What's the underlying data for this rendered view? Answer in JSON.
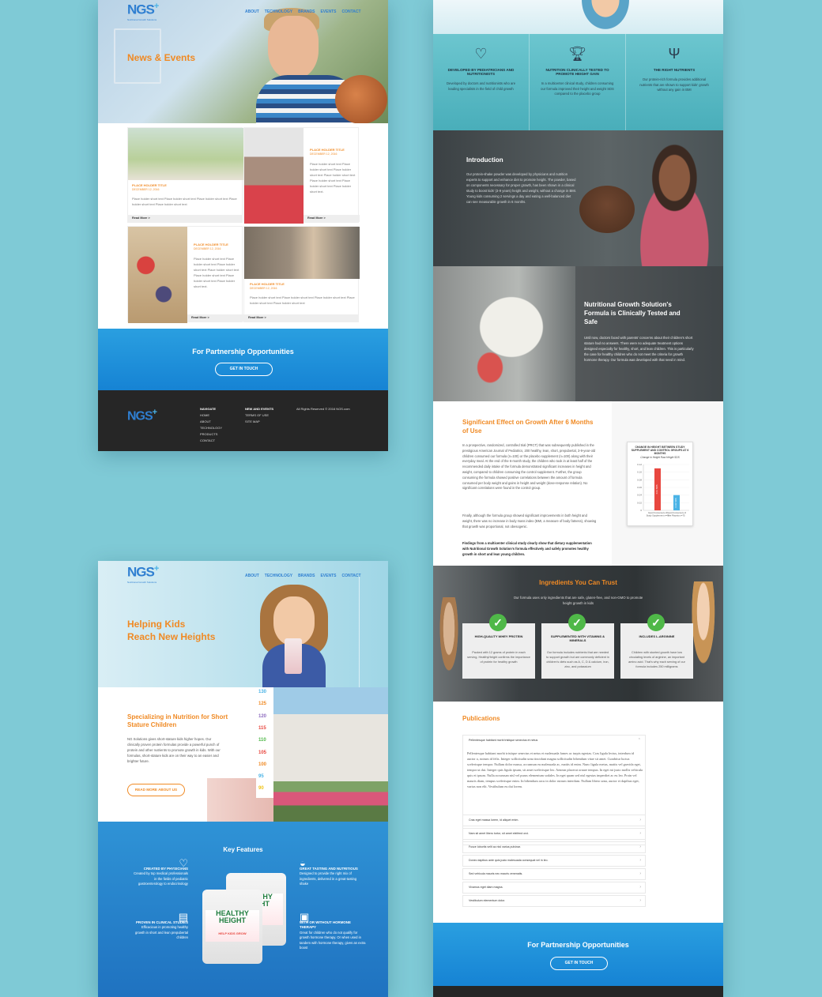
{
  "brand": {
    "logo": "NGS",
    "plus": "+",
    "tagline": "Nutritional Growth Solutions"
  },
  "nav": [
    "ABOUT",
    "TECHNOLOGY",
    "BRANDS",
    "EVENTS",
    "CONTACT"
  ],
  "news": {
    "title": "News & Events",
    "card_title": "PLACE HOLDER TITLE",
    "card_date": "DECEMBER 12, 2016",
    "short_text": "Place holder short text Place holder short text Place holder short text Place holder short text Place holder short text",
    "long_text": "Place holder short text Place holder short text Place holder short text Place holder short text Place holder short text Place holder short text Place holder short text.",
    "read_more": "Read More >"
  },
  "cta": {
    "title": "For Partnership Opportunities",
    "button": "GET IN TOUCH"
  },
  "footer": {
    "nav_head": "NAVIGATE",
    "nav_items": [
      "HOME",
      "ABOUT",
      "TECHNOLOGY",
      "PRODUCTS",
      "CONTACT"
    ],
    "col2": [
      "NEW AND EVENTS",
      "TERMS OF USE",
      "SITE MAP"
    ],
    "rights": "All Rights Reserved © 2016 NGS.com"
  },
  "features": [
    {
      "icon": "stethoscope-heart-icon",
      "title": "DEVELOPED BY PEDIATRICIANS AND NUTRITIONISTS",
      "text": "Developed by doctors and nutritionists who are leading specialists in the field of child growth"
    },
    {
      "icon": "trophy-icon",
      "title": "NUTRITION CLINICALLY TESTED TO PROMOTE HEIGHT GAIN",
      "text": "In a multicenter clinical study, children consuming our formula improved their height and weight SDS compared to the placebo group"
    },
    {
      "icon": "carrot-fork-icon",
      "title": "THE RIGHT NUTRIENTS",
      "text": "Our protein-rich formula provides additional nutrients that are shown to support kids' growth without any gain in BMI"
    }
  ],
  "intro": {
    "title": "Introduction",
    "text": "Our protein-shake powder was developed by physicians and nutrition experts to support and enhance diet to promote height. The powder, based on components necessary for proper growth, has been shown in a clinical study to boost kids' (3-9 years) height and weight, without a change in BMI. Young kids consuming 2 servings a day and eating a well-balanced diet can see measurable growth in 6 months."
  },
  "tested": {
    "title": "Nutritional Growth Solution's Formula is Clinically Tested and Safe",
    "text": "Until now, doctors faced with parents' concerns about their children's short stature had no answers. There were no adequate treatment options designed especially for healthy, short, and lean children. This is particularly the case for healthy children who do not meet the criteria for growth hormone therapy. Our formula was developed with that need in mind."
  },
  "effect": {
    "title": "Significant Effect on Growth After 6 Months of Use",
    "p1": "In a prospective, randomized, controlled trial (PRCT) that was subsequently published in the prestigious American Journal of Pediatrics, 200 healthy, lean, short, prepubertal, 3-9-year-old children consumed our formula (n=100) or the placebo supplement (n=100) along with their everyday meal. At the end of the 6-month study, the children who took in at least half of the recommended daily intake of the formula demonstrated significant increases in height and weight, compared to children consuming the control supplement. Further, the group consuming the formula showed positive correlations between the amount of formula consumed per body weight and gains in height and weight (dose-response relation). No significant correlations were found in the control group.",
    "p2": "Finally, although the formula group showed significant improvements in both height and weight, there was no increase in body mass index (BMI, a measure of body fatness), showing that growth was proportional, not obesogenic.",
    "p3": "Findings from a multicenter clinical study clearly show that dietary supplementation with Nutritional Growth Solution's formula effectively and safely promotes healthy growth in short and lean young children."
  },
  "chart_data": {
    "type": "bar",
    "title": "CHANGE IN HEIGHT BETWEEN STUDY SUPPLEMENT AND CONTROL GROUPS AT 6 MONTHS",
    "subtitle": "Change in Height Raw Height SDS",
    "categories": [
      "Good Consumers of Study Supplement n=49",
      "Good Consumers of the Placebo n=75"
    ],
    "values": [
      0.11,
      0.04
    ],
    "bar_labels": [
      "0.11 SDS",
      "0.04 SDS"
    ],
    "colors": [
      "#e8473f",
      "#4ab3e6"
    ],
    "yticks": [
      "0.12",
      "0.10",
      "0.08",
      "0.06",
      "0.04",
      "0.02",
      "0"
    ],
    "ylim": [
      0,
      0.12
    ]
  },
  "ingredients": {
    "title": "Ingredients You Can Trust",
    "sub": "Our formula uses only ingredients that are safe, gluten-free, and non-GMO to promote height growth in kids",
    "items": [
      {
        "title": "HIGH-QUALITY WHEY PROTEIN",
        "text": "Packed with 12 grams of protein in each serving, HealthyHeight confirms the importance of protein for healthy growth"
      },
      {
        "title": "SUPPLEMENTED WITH VITAMINS & MINERALS",
        "text": "Our formula includes nutrients that are needed to support growth but are commonly deficient in children's diets such as A, C, D & calcium, iron, zinc, and potassium"
      },
      {
        "title": "INCLUDES L-ARGININE",
        "text": "Children with stunted growth have low circulating levels of arginine, an important amino acid. That's why each serving of our formula includes 250 milligrams"
      }
    ]
  },
  "pubs": {
    "title": "Publications",
    "open_item": "Pellentesque habitant morbi tristique senectus et netus",
    "body": "Pellentesque habitant morbi tristique senectus et netus et malesuada fames ac turpis egestas. Cras ligula lectus, interdum id auctor a, rutrum id felis. Integer sollicitudin urna tincidunt magna sollicitudin bibendum vitae sit amet. Curabitur luctus scelerisque tempor. Nullam dolor massa, accumsan eu malesuada ac, mattis id enim. Nunc ligula metus, mattis vel gravida eget, tempor ut dui. Integer quis ligula ipsum, sit amet scelerisque leo. Aenean placerat ornare tempus. In eget mi justo mollis vehicula quis et ipsum. Nulla accumsan nisl vel purus elementum sodales. In eget quam sed nisl egestas imperdiet ac eu leo. Proin vel mauris diam, tempus scelerisque enim. In bibendum arcu in dolor rutrum interdum. Nullam libero urna, auctor et dapibus eget, varius non elit. Vestibulum eu dui lorem.",
    "items": [
      "Cras eget massa lorem, id aliquet enim.",
      "Nam sit amet libero tortor, sit amet eleifend orci.",
      "Fusce lobortis velit ac nisl varius pulvinar.",
      "Donec dapibus ante quis justo malesuada consequat vel in leo.",
      "Sed vehicula mauris nec mauris venenatis.",
      "Vivamus eget diam magna.",
      "Vestibulum elementum dolor."
    ]
  },
  "home": {
    "hero": "Helping Kids Reach New Heights",
    "hero_l1": "Helping Kids",
    "hero_l2": "Reach New Heights",
    "spec_title": "Specializing in Nutrition for Short Stature Children",
    "spec_text": "NG Solutions gives short-stature kids higher hopes. Our clinically proven protein formulas provide a powerful punch of protein and other nutrients to promote growth in kids. With our formulas, short-stature kids are on their way to an easier and brighter future.",
    "spec_button": "READ MORE ABOUT US",
    "heights": [
      "130",
      "125",
      "120",
      "115",
      "110",
      "105",
      "100",
      "95",
      "90"
    ],
    "height_colors": [
      "#4ab3e6",
      "#f08a24",
      "#8e6bbf",
      "#e8473f",
      "#4fb848",
      "#e8473f",
      "#f08a24",
      "#4ab3e6",
      "#f0c419"
    ]
  },
  "keyfeatures": {
    "title": "Key Features",
    "items": [
      {
        "icon": "physician-heart-icon",
        "title": "CREATED BY PHYSICIANS",
        "text": "Created by top medical professionals in the fields of pediatric gastroenterology to endocrinology"
      },
      {
        "icon": "clipboard-icon",
        "title": "PROVEN IN CLINICAL STUDIES",
        "text": "Efficacious in promoting healthy growth in short and lean prepubertal children"
      },
      {
        "icon": "bowl-spoon-icon",
        "title": "GREAT TASTING AND NUTRITIOUS",
        "text": "Designed to provide the right mix of ingredients, delivered in a great-tasting shake"
      },
      {
        "icon": "jar-icon",
        "title": "WITH OR WITHOUT HORMONE THERAPY",
        "text": "Great for children who do not qualify for growth hormone therapy. Or when used in tandem with hormone therapy, gives an extra boost"
      }
    ],
    "product": {
      "name1": "HEALTHY",
      "name2": "HEIGHT",
      "tag": "HELP KIDS GROW"
    }
  }
}
